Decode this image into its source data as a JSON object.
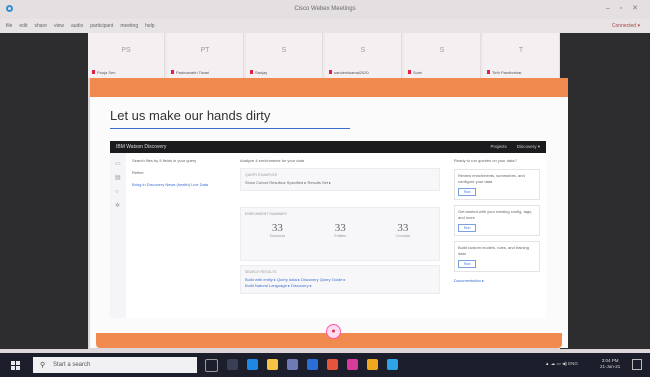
{
  "window": {
    "title": "Cisco Webex Meetings",
    "controls": "– ▫ ✕",
    "connected": "Connected ▾"
  },
  "menu": [
    "file",
    "edit",
    "share",
    "view",
    "audio",
    "participant",
    "meeting",
    "help"
  ],
  "participants": [
    {
      "initials": "PS",
      "name": "Pooja Sen"
    },
    {
      "initials": "PT",
      "name": "Padmanabh Tiwari"
    },
    {
      "initials": "S",
      "name": "Sanjay"
    },
    {
      "initials": "S",
      "name": "sandeshkamal2020"
    },
    {
      "initials": "S",
      "name": "Sumi"
    },
    {
      "initials": "T",
      "name": "Tirth Pandhrekar"
    }
  ],
  "slide": {
    "title": "Let us make our hands dirty",
    "record_glyph": "●"
  },
  "watson": {
    "product": "IBM Watson Discovery",
    "top_links": [
      "Projects",
      "Discovery ▾"
    ],
    "left": {
      "line1": "Search files by 5 fields in your query",
      "line2": "Refine",
      "line3": "Bring in Discovery News (health) Live Data"
    },
    "mid": {
      "header": "Analyze 4 enrichments for your data",
      "card1_label": "QUERY EXAMPLES",
      "card1_text": "Show Cohort Results ▸ Specified ▸ Results Set ▸",
      "card2_label": "ENRICHMENT SUMMARY",
      "stats": [
        {
          "num": "33",
          "label": "Keywords"
        },
        {
          "num": "33",
          "label": "Entities"
        },
        {
          "num": "33",
          "label": "Concepts"
        }
      ],
      "card3_label": "SEARCH RESULTS",
      "card3_line1": "Build with entity ▸ Query data ▸ Discovery Query Guide ▸",
      "card3_line2": "Build Natural Language ▸ Discovery ▸"
    },
    "right": {
      "header": "Ready to run queries on your data?",
      "cards": [
        {
          "text": "Review enrichments, summaries, and configure your data",
          "button": "Run"
        },
        {
          "text": "Get started with your existing config, tags, and more",
          "button": "Run"
        },
        {
          "text": "Build custom models, rules, and training data",
          "button": "Run"
        }
      ],
      "footer_link": "Documentation ▸"
    }
  },
  "taskbar": {
    "search_placeholder": "Start a search",
    "tray": "▲ ☁ ▭ ◀) ENG",
    "time": "3:04 PM",
    "date": "21-Jun-21"
  },
  "colors": {
    "accent_orange": "#f08a4e",
    "title_rule": "#3b6fcf",
    "taskbar": "#1c1f2b",
    "webex_dark": "#2d2c2e"
  }
}
